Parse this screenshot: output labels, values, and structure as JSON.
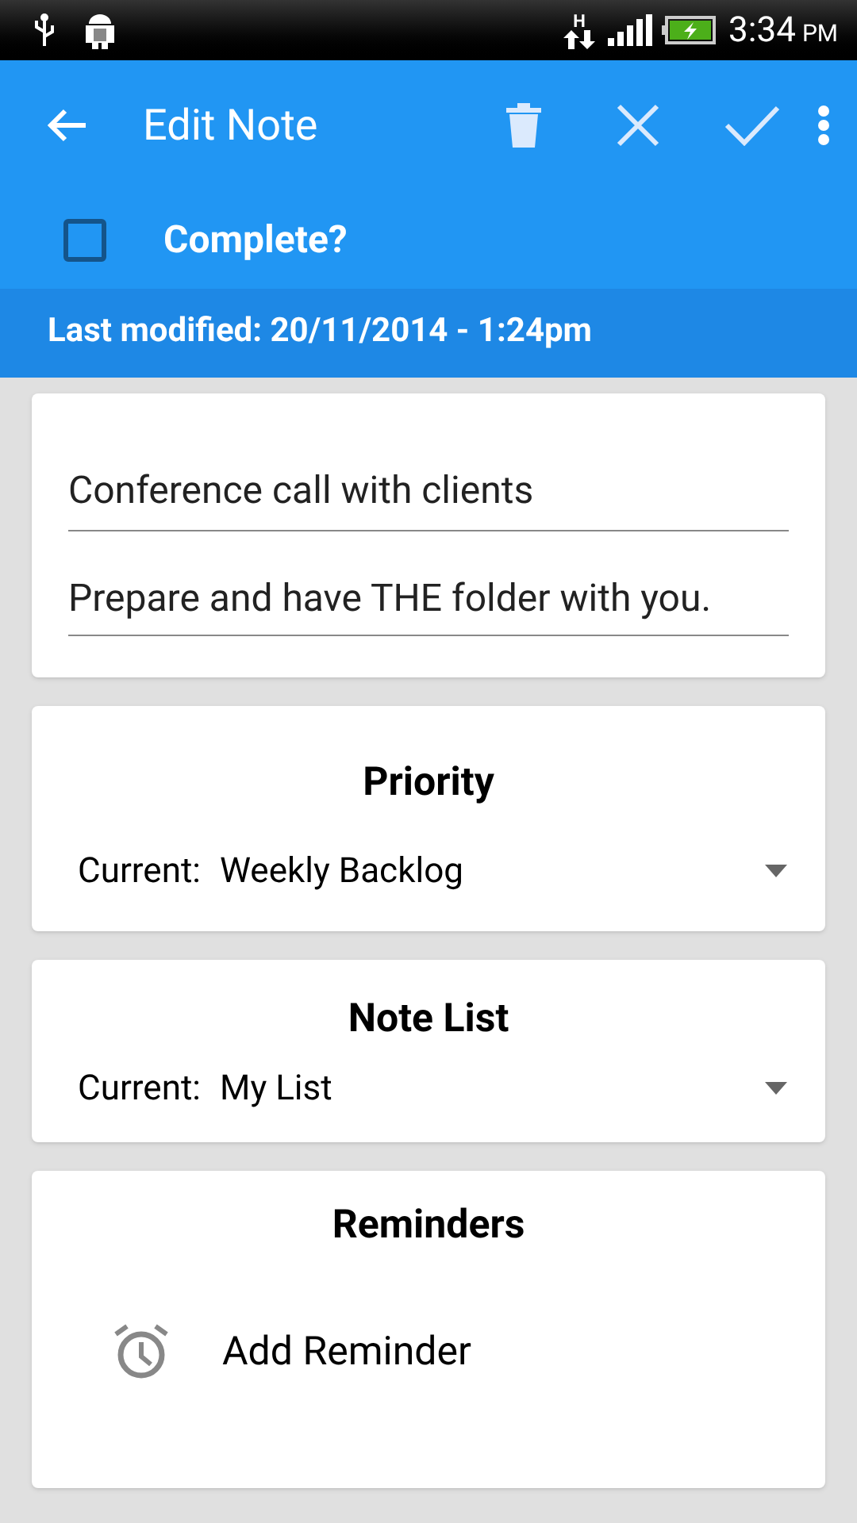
{
  "status_bar": {
    "network": "H",
    "time": "3:34",
    "ampm": "PM"
  },
  "toolbar": {
    "title": "Edit Note"
  },
  "complete": {
    "label": "Complete?",
    "checked": false
  },
  "last_modified": "Last modified: 20/11/2014 - 1:24pm",
  "note": {
    "title": "Conference call with clients",
    "body": "Prepare and have THE folder with you."
  },
  "selectors": [
    {
      "title": "Priority",
      "label": "Current:",
      "value": "Weekly Backlog"
    },
    {
      "title": "Note List",
      "label": "Current:",
      "value": "My List"
    }
  ],
  "reminders": {
    "title": "Reminders",
    "action": "Add Reminder"
  }
}
